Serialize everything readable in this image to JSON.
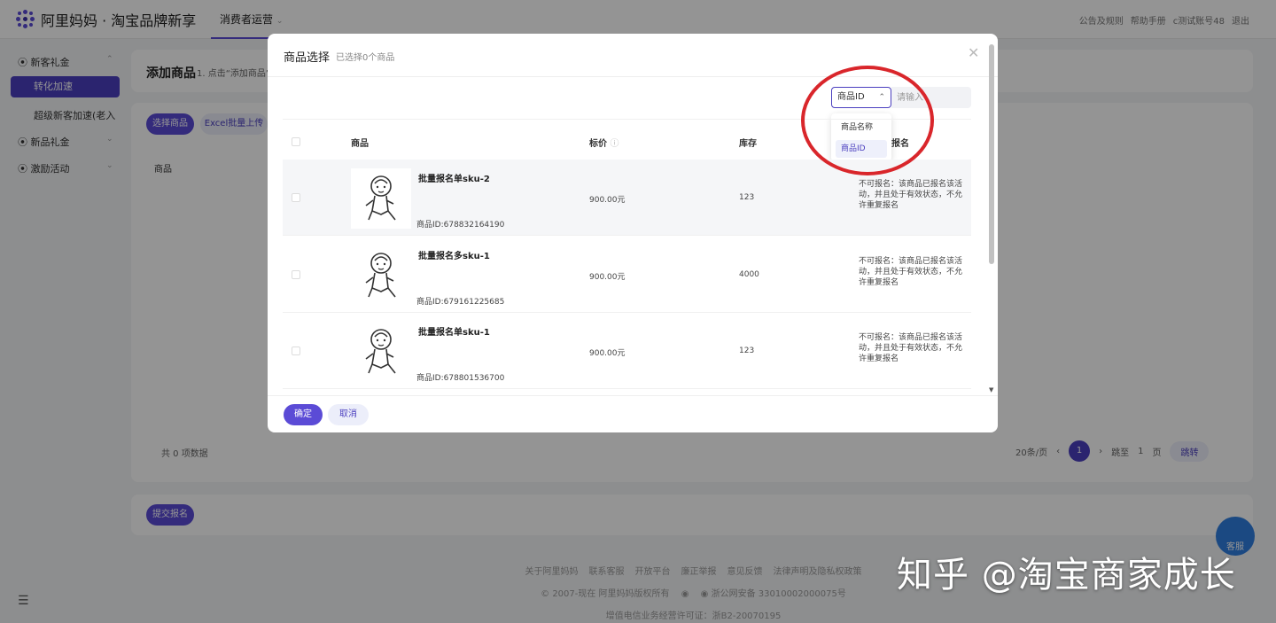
{
  "app": {
    "logo_text": "阿里妈妈 · 淘宝品牌新享",
    "nav_tab": "消费者运营",
    "top_links": [
      "公告及规则",
      "帮助手册",
      "c测试账号48",
      "退出"
    ]
  },
  "sidebar": {
    "groups": [
      {
        "label": "新客礼金"
      },
      {
        "label": "新品礼金"
      },
      {
        "label": "激励活动"
      }
    ],
    "active_item": "转化加速",
    "sub_item": "超级新客加速(老入"
  },
  "page": {
    "card_title": "添加商品",
    "card_hint": "1. 点击“添加商品”",
    "select_goods_button": "选择商品",
    "excel_button": "Excel批量上传",
    "column_goods": "商品",
    "total_text": "共 0 项数据",
    "submit_button": "提交报名",
    "pager": {
      "page_size": "20条/页",
      "current": "1",
      "jump_label": "跳至",
      "jump_value": "1",
      "page_suffix": "页",
      "jump_button": "跳转"
    }
  },
  "footer": {
    "links": [
      "关于阿里妈妈",
      "联系客服",
      "开放平台",
      "廉正举报",
      "意见反馈",
      "法律声明及隐私权政策"
    ],
    "copyright": "© 2007-现在 阿里妈妈版权所有",
    "icp": "浙公网安备 33010002000075号",
    "license": "增值电信业务经营许可证：浙B2-20070195"
  },
  "help_float": "客服",
  "modal": {
    "title": "商品选择",
    "subtitle": "已选择0个商品",
    "close_icon": "close-icon",
    "filter": {
      "selected": "商品ID",
      "placeholder": "请输入",
      "options": [
        {
          "label": "商品名称"
        },
        {
          "label": "商品ID"
        }
      ]
    },
    "columns": {
      "goods": "商品",
      "price": "标价",
      "stock": "库存",
      "status": "报名"
    },
    "rows": [
      {
        "name": "批量报名单sku-2",
        "id": "商品ID:678832164190",
        "price": "900.00元",
        "stock": "123",
        "status": "不可报名：该商品已报名该活动，并且处于有效状态，不允许重复报名"
      },
      {
        "name": "批量报名多sku-1",
        "id": "商品ID:679161225685",
        "price": "900.00元",
        "stock": "4000",
        "status": "不可报名：该商品已报名该活动，并且处于有效状态，不允许重复报名"
      },
      {
        "name": "批量报名单sku-1",
        "id": "商品ID:678801536700",
        "price": "900.00元",
        "stock": "123",
        "status": "不可报名：该商品已报名该活动，并且处于有效状态，不允许重复报名"
      }
    ],
    "ok_button": "确定",
    "cancel_button": "取消"
  },
  "watermark": "知乎 @淘宝商家成长",
  "colors": {
    "accent": "#5b4bd6",
    "annotation": "#d9262b"
  }
}
